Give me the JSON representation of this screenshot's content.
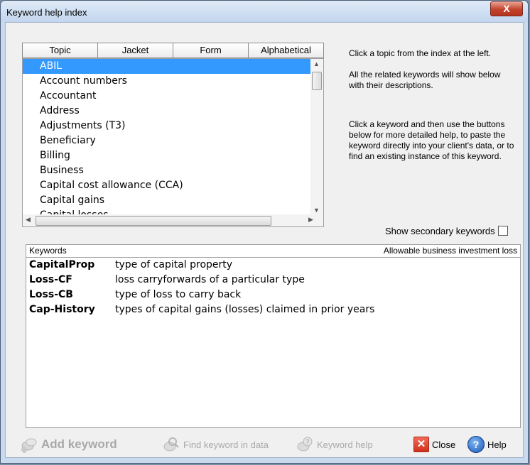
{
  "window": {
    "title": "Keyword help index",
    "close_glyph": "X"
  },
  "tabs": [
    "Topic",
    "Jacket",
    "Form",
    "Alphabetical"
  ],
  "topics": [
    "ABIL",
    "Account numbers",
    "Accountant",
    "Address",
    "Adjustments (T3)",
    "Beneficiary",
    "Billing",
    "Business",
    "Capital cost allowance (CCA)",
    "Capital gains",
    "Capital losses"
  ],
  "selected_topic": "ABIL",
  "help_text": {
    "p1": "Click a topic from the index at the left.",
    "p2": "All the related keywords will show below with their descriptions.",
    "p3": "Click a keyword and then use the buttons below for more detailed help, to paste the keyword directly into your client's data, or to find an existing instance of this keyword."
  },
  "show_secondary_label": "Show secondary keywords",
  "show_secondary_checked": false,
  "keywords_header": {
    "left": "Keywords",
    "right": "Allowable business investment loss"
  },
  "keywords": [
    {
      "name": "CapitalProp",
      "desc": "type of capital property"
    },
    {
      "name": "Loss-CF",
      "desc": "loss carryforwards of a particular type"
    },
    {
      "name": "Loss-CB",
      "desc": "type of loss to carry back"
    },
    {
      "name": "Cap-History",
      "desc": "types of capital gains (losses) claimed in prior years"
    }
  ],
  "buttons": {
    "add_keyword": "Add keyword",
    "find_keyword": "Find keyword in data",
    "keyword_help": "Keyword help",
    "close": "Close",
    "help": "Help"
  },
  "icons": {
    "add": "add-keyword-icon",
    "find": "find-keyword-icon",
    "help_kw": "keyword-help-icon",
    "close": "close-icon",
    "help": "help-icon"
  },
  "colors": {
    "selection": "#3399ff",
    "close_red": "#d0311d",
    "help_blue": "#1a57b5"
  }
}
